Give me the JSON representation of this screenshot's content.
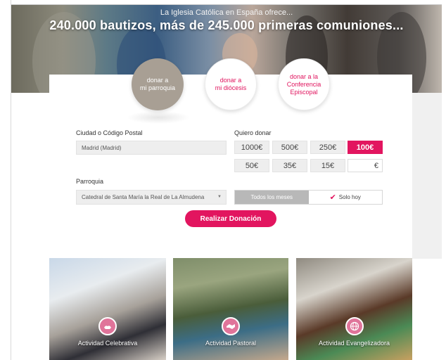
{
  "hero": {
    "subtitle": "La Iglesia Católica en España ofrece...",
    "title": "240.000 bautizos, más de 245.000 primeras comuniones..."
  },
  "tabs": [
    {
      "label_line1": "donar a",
      "label_line2": "mi parroquia",
      "active": true
    },
    {
      "label_line1": "donar a",
      "label_line2": "mi diócesis",
      "active": false
    },
    {
      "label_line1": "donar a la",
      "label_line2": "Conferencia",
      "label_line3": "Episcopal",
      "active": false
    }
  ],
  "form": {
    "city_label": "Ciudad o Código Postal",
    "city_value": "Madrid (Madrid)",
    "parish_label": "Parroquia",
    "parish_value": "Catedral de Santa María la Real de La Almudena",
    "amount_label": "Quiero donar",
    "amounts": [
      "1000€",
      "500€",
      "250€",
      "100€",
      "50€",
      "35€",
      "15€"
    ],
    "selected_amount": "100€",
    "custom_currency": "€",
    "frequency_options": [
      "Todos los meses",
      "Solo hoy"
    ],
    "selected_frequency": "Solo hoy",
    "submit_label": "Realizar Donación"
  },
  "activities": [
    {
      "label": "Actividad Celebrativa",
      "icon": "hands-icon"
    },
    {
      "label": "Actividad Pastoral",
      "icon": "handshake-icon"
    },
    {
      "label": "Actividad Evangelizadora",
      "icon": "globe-icon"
    }
  ],
  "colors": {
    "accent": "#e2155f",
    "active_tab": "#a89f94"
  }
}
